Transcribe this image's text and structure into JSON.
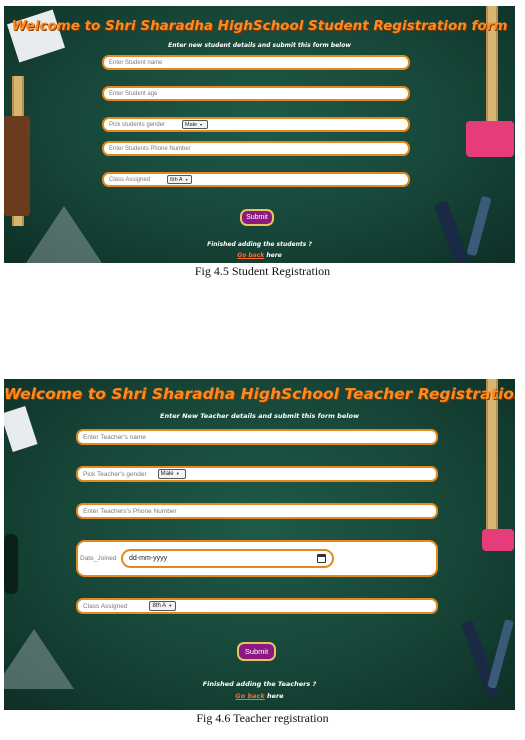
{
  "student_form": {
    "title": "Welcome to Shri Sharadha HighSchool Student Registration form",
    "subtitle": "Enter new student details and submit this form below",
    "name_placeholder": "Enter Student name",
    "age_placeholder": "Enter Student age",
    "gender_label": "Pick students gender",
    "gender_value": "Male",
    "phone_placeholder": "Enter Students Phone Number",
    "class_label": "Class Assigned",
    "class_value": "6th A",
    "submit_label": "Submit",
    "finished_text": "Finished adding the students ?",
    "go_back_link": "Go back",
    "here_text": "here"
  },
  "student_caption": "Fig 4.5 Student Registration",
  "teacher_form": {
    "title": "Welcome to Shri Sharadha HighSchool Teacher Registration form",
    "subtitle": "Enter New Teacher details and submit this form below",
    "name_placeholder": "Enter Teacher's name",
    "gender_label": "Pick Teacher's gender",
    "gender_value": "Male",
    "phone_placeholder": "Enter Teachers's Phone Number",
    "date_label": "Date_Joined",
    "date_placeholder": "dd-mm-yyyy",
    "class_label": "Class Assigned",
    "class_value": "8th A",
    "submit_label": "Submit",
    "finished_text": "Finished adding the Teachers ?",
    "go_back_link": "Go back",
    "here_text": "here"
  },
  "teacher_caption": "Fig 4.6 Teacher registration",
  "colors": {
    "background": "#174638",
    "title": "#ff8a1e",
    "field_border": "#e48a1c",
    "submit_bg": "#8a1a82",
    "link": "#ff6a2e"
  }
}
